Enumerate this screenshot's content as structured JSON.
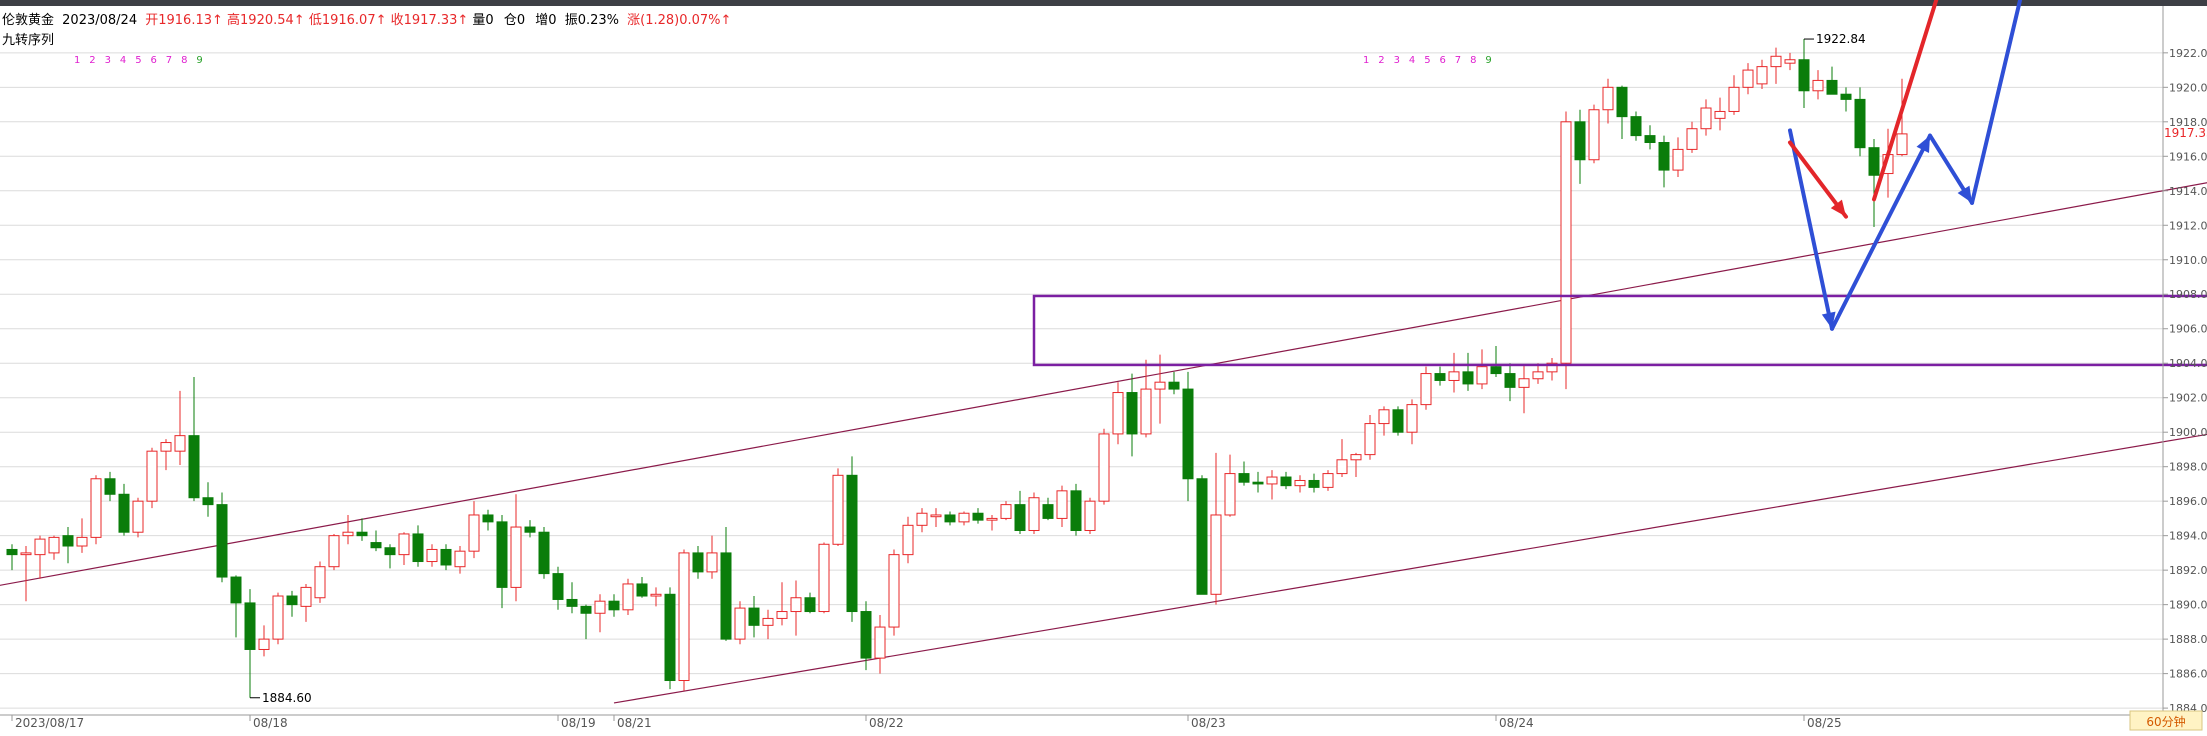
{
  "header": {
    "symbol": "伦敦黄金",
    "date": "2023/08/24",
    "open": "开1916.13↑",
    "high": "高1920.54↑",
    "low": "低1916.07↑",
    "close": "收1917.33↑",
    "volume": "量0",
    "open_interest": "仓0",
    "increase": "增0",
    "amplitude": "振0.23%",
    "change": "涨(1.28)0.07%↑",
    "indicator_name": "九转序列"
  },
  "sequence_labels": {
    "group1": [
      "1",
      "2",
      "3",
      "4",
      "5",
      "6",
      "7",
      "8",
      "9"
    ],
    "group2": [
      "1",
      "2",
      "3",
      "4",
      "5",
      "6",
      "7",
      "8",
      "9"
    ]
  },
  "current_price": "1917.33",
  "annotations": {
    "low_label": "1884.60",
    "high_label": "1922.84"
  },
  "period": "60分钟",
  "colors": {
    "up": "#e8282a",
    "down": "#0a7d0a",
    "channel": "#8b1a4a",
    "box": "#7b1fa2",
    "arrow_blue": "#2f4fd6",
    "arrow_red": "#e3262a",
    "grid": "#dcdcdc"
  },
  "chart_data": {
    "type": "candlestick",
    "instrument": "伦敦黄金",
    "timeframe": "60分钟",
    "ylim": [
      1883.6,
      1924.6
    ],
    "y_ticks": [
      "1884.00",
      "1886.00",
      "1888.00",
      "1890.00",
      "1892.00",
      "1894.00",
      "1896.00",
      "1898.00",
      "1900.00",
      "1902.00",
      "1904.00",
      "1906.00",
      "1908.00",
      "1910.00",
      "1912.00",
      "1914.00",
      "1916.00",
      "1918.00",
      "1920.00",
      "1922.00"
    ],
    "x_ticks": [
      {
        "label": "2023/08/17",
        "index": 0
      },
      {
        "label": "08/18",
        "index": 17
      },
      {
        "label": "08/19",
        "index": 39
      },
      {
        "label": "08/21",
        "index": 43
      },
      {
        "label": "08/22",
        "index": 61
      },
      {
        "label": "08/23",
        "index": 84
      },
      {
        "label": "08/24",
        "index": 106
      },
      {
        "label": "08/25",
        "index": 128
      }
    ],
    "candles": [
      [
        1893.2,
        1893.5,
        1892.0,
        1892.9
      ],
      [
        1892.9,
        1893.4,
        1890.2,
        1893.0
      ],
      [
        1892.9,
        1894.0,
        1891.5,
        1893.8
      ],
      [
        1893.0,
        1894.0,
        1892.6,
        1893.9
      ],
      [
        1894.0,
        1894.5,
        1892.4,
        1893.4
      ],
      [
        1893.4,
        1895.0,
        1893.0,
        1893.9
      ],
      [
        1893.9,
        1897.5,
        1893.5,
        1897.3
      ],
      [
        1897.3,
        1897.7,
        1896.0,
        1896.4
      ],
      [
        1896.4,
        1897.0,
        1894.0,
        1894.2
      ],
      [
        1894.2,
        1896.2,
        1893.9,
        1896.0
      ],
      [
        1896.0,
        1899.1,
        1895.6,
        1898.9
      ],
      [
        1898.9,
        1899.6,
        1897.8,
        1899.4
      ],
      [
        1898.9,
        1902.4,
        1898.1,
        1899.8
      ],
      [
        1899.8,
        1903.2,
        1896.0,
        1896.2
      ],
      [
        1896.2,
        1897.1,
        1895.1,
        1895.8
      ],
      [
        1895.8,
        1896.5,
        1891.3,
        1891.6
      ],
      [
        1891.6,
        1891.7,
        1888.1,
        1890.1
      ],
      [
        1890.1,
        1890.9,
        1884.6,
        1887.4
      ],
      [
        1887.4,
        1888.8,
        1887.0,
        1888.0
      ],
      [
        1888.0,
        1890.7,
        1887.7,
        1890.5
      ],
      [
        1890.5,
        1890.8,
        1889.3,
        1890.0
      ],
      [
        1889.9,
        1891.2,
        1889.0,
        1891.0
      ],
      [
        1890.4,
        1892.5,
        1890.1,
        1892.2
      ],
      [
        1892.2,
        1894.1,
        1892.0,
        1894.0
      ],
      [
        1894.0,
        1895.2,
        1893.5,
        1894.2
      ],
      [
        1894.2,
        1895.0,
        1893.7,
        1894.0
      ],
      [
        1893.6,
        1894.3,
        1893.1,
        1893.3
      ],
      [
        1893.3,
        1893.5,
        1892.1,
        1892.9
      ],
      [
        1892.9,
        1894.2,
        1892.3,
        1894.1
      ],
      [
        1894.1,
        1894.6,
        1892.2,
        1892.5
      ],
      [
        1892.5,
        1893.5,
        1892.2,
        1893.2
      ],
      [
        1893.2,
        1893.5,
        1892.0,
        1892.3
      ],
      [
        1892.2,
        1893.4,
        1891.8,
        1893.1
      ],
      [
        1893.1,
        1896.0,
        1892.7,
        1895.2
      ],
      [
        1895.2,
        1895.5,
        1894.3,
        1894.8
      ],
      [
        1894.8,
        1895.2,
        1889.8,
        1891.0
      ],
      [
        1891.0,
        1896.4,
        1890.2,
        1894.5
      ],
      [
        1894.5,
        1894.9,
        1893.9,
        1894.2
      ],
      [
        1894.2,
        1894.5,
        1891.5,
        1891.8
      ],
      [
        1891.8,
        1892.2,
        1889.7,
        1890.3
      ],
      [
        1890.3,
        1891.3,
        1889.5,
        1889.9
      ],
      [
        1889.9,
        1890.0,
        1888.0,
        1889.5
      ],
      [
        1889.5,
        1890.6,
        1888.4,
        1890.2
      ],
      [
        1890.2,
        1890.6,
        1889.3,
        1889.7
      ],
      [
        1889.7,
        1891.5,
        1889.4,
        1891.2
      ],
      [
        1891.2,
        1891.6,
        1890.4,
        1890.5
      ],
      [
        1890.5,
        1891.0,
        1889.9,
        1890.6
      ],
      [
        1890.6,
        1891.0,
        1885.1,
        1885.6
      ],
      [
        1885.6,
        1893.2,
        1885.0,
        1893.0
      ],
      [
        1893.0,
        1893.4,
        1891.5,
        1891.9
      ],
      [
        1891.9,
        1894.0,
        1891.5,
        1893.0
      ],
      [
        1893.0,
        1894.5,
        1887.9,
        1888.0
      ],
      [
        1888.0,
        1890.2,
        1887.7,
        1889.8
      ],
      [
        1889.8,
        1890.5,
        1888.1,
        1888.8
      ],
      [
        1888.8,
        1889.7,
        1888.0,
        1889.2
      ],
      [
        1889.2,
        1891.3,
        1888.8,
        1889.6
      ],
      [
        1889.6,
        1891.4,
        1888.2,
        1890.4
      ],
      [
        1890.4,
        1890.7,
        1889.5,
        1889.6
      ],
      [
        1889.6,
        1893.6,
        1889.5,
        1893.5
      ],
      [
        1893.5,
        1897.9,
        1893.4,
        1897.5
      ],
      [
        1897.5,
        1898.6,
        1889.0,
        1889.6
      ],
      [
        1889.6,
        1890.2,
        1886.2,
        1886.9
      ],
      [
        1886.9,
        1889.4,
        1886.0,
        1888.7
      ],
      [
        1888.7,
        1893.2,
        1888.2,
        1892.9
      ],
      [
        1892.9,
        1895.1,
        1892.4,
        1894.6
      ],
      [
        1894.6,
        1895.6,
        1894.2,
        1895.3
      ],
      [
        1895.1,
        1895.6,
        1894.5,
        1895.2
      ],
      [
        1895.2,
        1895.4,
        1894.6,
        1894.8
      ],
      [
        1894.8,
        1895.4,
        1894.6,
        1895.3
      ],
      [
        1895.3,
        1895.6,
        1894.7,
        1894.9
      ],
      [
        1894.9,
        1895.2,
        1894.3,
        1895.0
      ],
      [
        1895.0,
        1896.0,
        1894.9,
        1895.8
      ],
      [
        1895.8,
        1896.6,
        1894.1,
        1894.3
      ],
      [
        1894.3,
        1896.5,
        1894.1,
        1896.2
      ],
      [
        1895.8,
        1896.2,
        1894.9,
        1895.0
      ],
      [
        1895.0,
        1896.9,
        1894.5,
        1896.6
      ],
      [
        1896.6,
        1897.0,
        1894.0,
        1894.3
      ],
      [
        1894.3,
        1896.2,
        1894.1,
        1896.0
      ],
      [
        1896.0,
        1900.2,
        1895.8,
        1899.9
      ],
      [
        1899.9,
        1902.9,
        1899.3,
        1902.3
      ],
      [
        1902.3,
        1903.4,
        1898.6,
        1899.9
      ],
      [
        1899.9,
        1904.2,
        1899.7,
        1902.5
      ],
      [
        1902.5,
        1904.5,
        1900.5,
        1902.9
      ],
      [
        1902.9,
        1903.5,
        1902.2,
        1902.5
      ],
      [
        1902.5,
        1903.5,
        1896.0,
        1897.3
      ],
      [
        1897.3,
        1897.5,
        1890.8,
        1890.6
      ],
      [
        1890.6,
        1898.8,
        1890.0,
        1895.2
      ],
      [
        1895.2,
        1898.7,
        1895.1,
        1897.6
      ],
      [
        1897.6,
        1898.3,
        1896.9,
        1897.1
      ],
      [
        1897.1,
        1897.7,
        1896.5,
        1897.0
      ],
      [
        1897.0,
        1897.8,
        1896.1,
        1897.4
      ],
      [
        1897.4,
        1897.7,
        1896.7,
        1896.9
      ],
      [
        1896.9,
        1897.5,
        1896.5,
        1897.2
      ],
      [
        1897.2,
        1897.6,
        1896.5,
        1896.8
      ],
      [
        1896.8,
        1897.8,
        1896.6,
        1897.6
      ],
      [
        1897.6,
        1899.6,
        1897.4,
        1898.4
      ],
      [
        1898.4,
        1898.8,
        1897.4,
        1898.7
      ],
      [
        1898.7,
        1901.0,
        1898.4,
        1900.5
      ],
      [
        1900.5,
        1901.5,
        1899.8,
        1901.3
      ],
      [
        1901.3,
        1901.5,
        1899.8,
        1900.0
      ],
      [
        1900.0,
        1901.9,
        1899.3,
        1901.6
      ],
      [
        1901.6,
        1903.8,
        1901.3,
        1903.4
      ],
      [
        1903.4,
        1903.8,
        1902.7,
        1903.0
      ],
      [
        1903.0,
        1904.6,
        1902.3,
        1903.5
      ],
      [
        1903.5,
        1904.6,
        1902.4,
        1902.8
      ],
      [
        1902.8,
        1904.8,
        1902.5,
        1903.8
      ],
      [
        1903.8,
        1905.0,
        1903.2,
        1903.4
      ],
      [
        1903.4,
        1904.0,
        1901.8,
        1902.6
      ],
      [
        1902.6,
        1903.9,
        1901.1,
        1903.1
      ],
      [
        1903.1,
        1904.0,
        1902.8,
        1903.5
      ],
      [
        1903.5,
        1904.3,
        1903.0,
        1904.0
      ],
      [
        1904.0,
        1918.6,
        1902.5,
        1918.0
      ],
      [
        1918.0,
        1918.7,
        1914.4,
        1915.8
      ],
      [
        1915.8,
        1919.0,
        1915.6,
        1918.7
      ],
      [
        1918.7,
        1920.5,
        1917.9,
        1920.0
      ],
      [
        1920.0,
        1920.1,
        1917.0,
        1918.3
      ],
      [
        1918.3,
        1918.6,
        1916.9,
        1917.2
      ],
      [
        1917.2,
        1917.8,
        1916.4,
        1916.8
      ],
      [
        1916.8,
        1917.2,
        1914.2,
        1915.2
      ],
      [
        1915.2,
        1917.1,
        1914.8,
        1916.4
      ],
      [
        1916.4,
        1918.0,
        1916.2,
        1917.6
      ],
      [
        1917.6,
        1919.3,
        1917.2,
        1918.8
      ],
      [
        1918.2,
        1919.4,
        1917.5,
        1918.6
      ],
      [
        1918.6,
        1920.7,
        1918.4,
        1920.0
      ],
      [
        1920.0,
        1921.4,
        1919.6,
        1921.0
      ],
      [
        1920.2,
        1921.6,
        1919.9,
        1921.2
      ],
      [
        1921.2,
        1922.3,
        1920.2,
        1921.8
      ],
      [
        1921.4,
        1922.0,
        1921.0,
        1921.6
      ],
      [
        1921.6,
        1922.8,
        1918.8,
        1919.8
      ],
      [
        1919.8,
        1921.0,
        1919.3,
        1920.4
      ],
      [
        1920.4,
        1921.2,
        1919.6,
        1919.6
      ],
      [
        1919.6,
        1920.0,
        1918.6,
        1919.3
      ],
      [
        1919.3,
        1920.0,
        1916.0,
        1916.5
      ],
      [
        1916.5,
        1917.0,
        1911.9,
        1914.9
      ],
      [
        1915.0,
        1917.6,
        1913.6,
        1916.1
      ],
      [
        1916.1,
        1920.5,
        1916.0,
        1917.3
      ]
    ],
    "channel_lines": [
      {
        "name": "upper",
        "from": {
          "index": -1,
          "price": 1891.1
        },
        "to": {
          "index": 157,
          "price": 1914.5
        }
      },
      {
        "name": "lower",
        "from": {
          "index": 43,
          "price": 1884.3
        },
        "to": {
          "index": 157,
          "price": 1899.9
        }
      }
    ],
    "zone_box": {
      "from_index": 73,
      "to_index": 157,
      "price_low": 1903.9,
      "price_high": 1907.9
    },
    "projection_arrows": [
      {
        "color": "blue",
        "points": [
          [
            127,
            1917.5
          ],
          [
            130,
            1906.0
          ],
          [
            137,
            1917.2
          ],
          [
            140,
            1913.3
          ],
          [
            144,
            1927.0
          ]
        ]
      },
      {
        "color": "red",
        "points": [
          [
            127,
            1916.8
          ],
          [
            131,
            1912.5
          ]
        ]
      },
      {
        "color": "red",
        "points": [
          [
            133,
            1913.5
          ],
          [
            138,
            1926.5
          ]
        ]
      }
    ]
  }
}
